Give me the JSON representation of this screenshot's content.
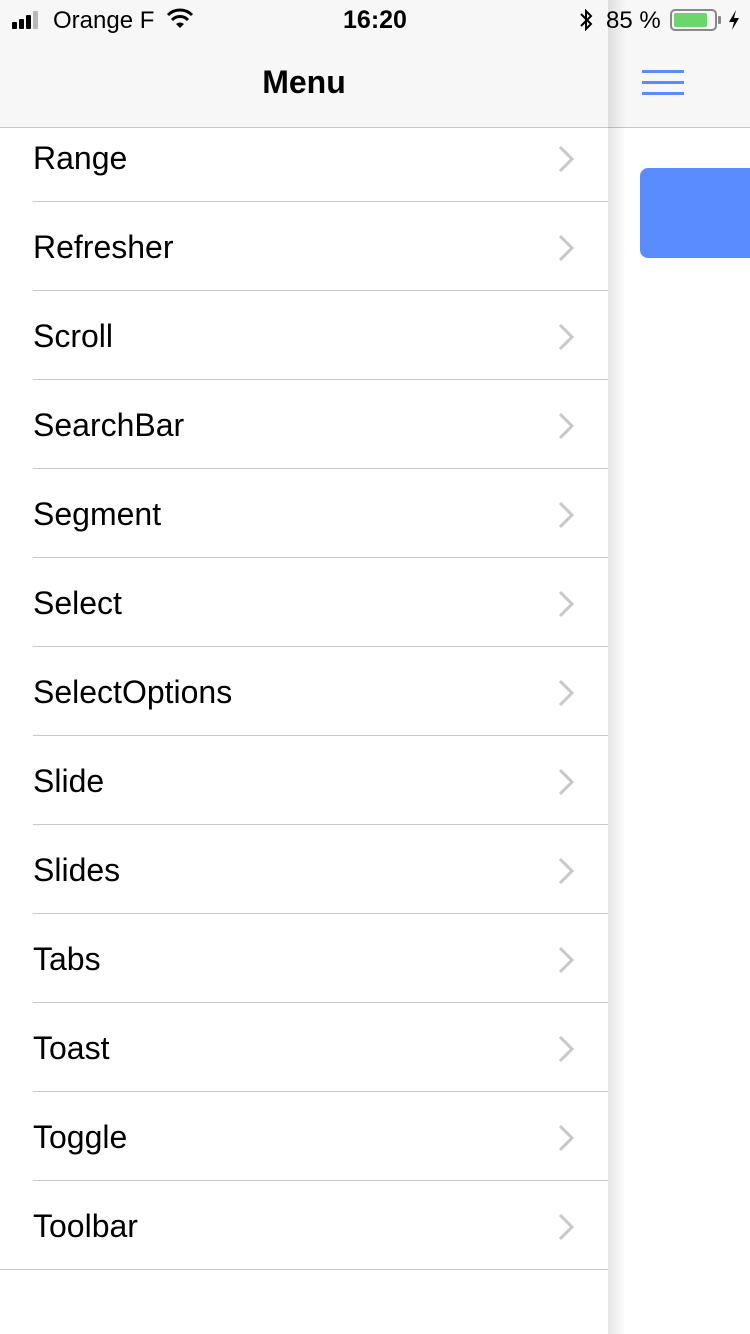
{
  "status_bar": {
    "carrier": "Orange F",
    "time": "16:20",
    "battery_percent": "85 %",
    "battery_level": 0.85,
    "battery_color": "#6dd56e"
  },
  "menu": {
    "title": "Menu",
    "items": [
      {
        "label": "Range"
      },
      {
        "label": "Refresher"
      },
      {
        "label": "Scroll"
      },
      {
        "label": "SearchBar"
      },
      {
        "label": "Segment"
      },
      {
        "label": "Select"
      },
      {
        "label": "SelectOptions"
      },
      {
        "label": "Slide"
      },
      {
        "label": "Slides"
      },
      {
        "label": "Tabs"
      },
      {
        "label": "Toast"
      },
      {
        "label": "Toggle"
      },
      {
        "label": "Toolbar"
      }
    ]
  },
  "main": {
    "menu_icon": "hamburger-icon",
    "accent_color": "#5b8cff"
  }
}
